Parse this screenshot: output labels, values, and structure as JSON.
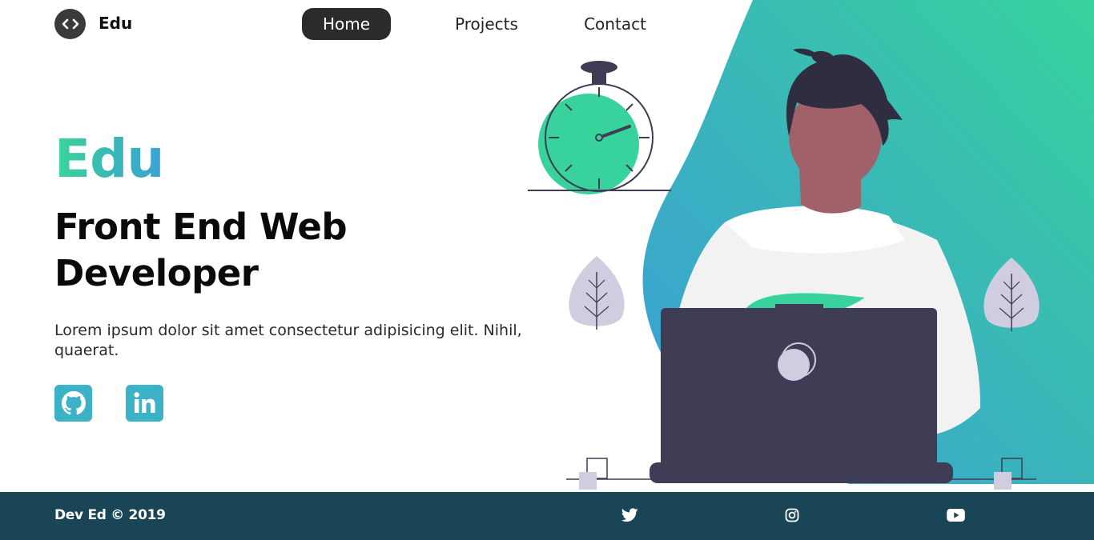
{
  "colors": {
    "accent_green": "#3ad49b",
    "accent_blue": "#3ba2d6",
    "teal_button": "#3bb2c5",
    "nav_active_bg": "#2b2b2b",
    "footer_bg": "#194556",
    "laptop": "#3f3c56",
    "hair": "#2f2e41",
    "skin": "#a0616a"
  },
  "header": {
    "logo_icon": "code-brackets-icon",
    "logo_text": "Edu",
    "nav": [
      {
        "label": "Home",
        "active": true
      },
      {
        "label": "Projects",
        "active": false
      },
      {
        "label": "Contact",
        "active": false
      }
    ]
  },
  "hero": {
    "brand": "Edu",
    "title": "Front End Web Developer",
    "description": "Lorem ipsum dolor sit amet consectetur adipisicing elit. Nihil, quaerat.",
    "socials": [
      {
        "name": "github",
        "icon": "github-icon"
      },
      {
        "name": "linkedin",
        "icon": "linkedin-icon"
      }
    ]
  },
  "footer": {
    "copyright": "Dev Ed © 2019",
    "icons": [
      "twitter-icon",
      "instagram-icon",
      "youtube-icon"
    ]
  }
}
